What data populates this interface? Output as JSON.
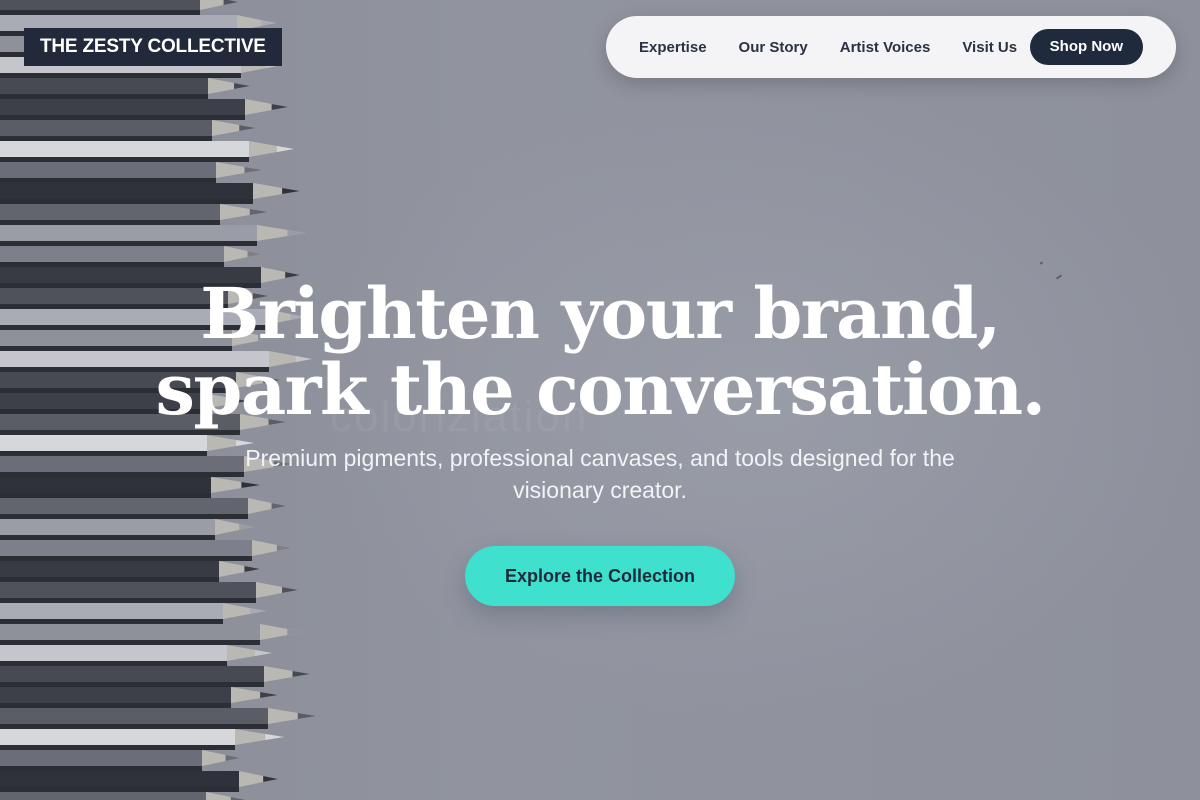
{
  "brand": {
    "logo_text": "THE ZESTY COLLECTIVE"
  },
  "nav": {
    "items": [
      {
        "label": "Expertise"
      },
      {
        "label": "Our Story"
      },
      {
        "label": "Artist Voices"
      },
      {
        "label": "Visit Us"
      }
    ],
    "cta_label": "Shop Now"
  },
  "hero": {
    "title_line1": "Brighten your brand,",
    "title_line2": "spark the conversation.",
    "subtitle": "Premium pigments, professional canvases, and tools designed for the visionary creator.",
    "cta_label": "Explore the Collection",
    "background_image": "colored-pencils-grayscale",
    "background_watermark": "colorizlation"
  },
  "colors": {
    "logo_bg": "#22293a",
    "nav_bg": "#f4f4f6",
    "shop_button_bg": "#1f2a3d",
    "cta_bg": "#40e0cf",
    "cta_text": "#1e2a3a",
    "hero_text": "#ffffff",
    "overlay": "#8d909b"
  }
}
